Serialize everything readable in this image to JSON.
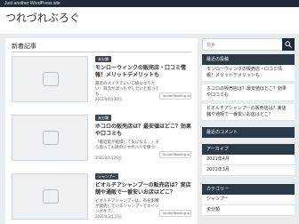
{
  "topbar": {
    "text": "Just another WordPress site"
  },
  "site": {
    "title": "つれづれぶろぐ"
  },
  "main": {
    "title": "新着記事",
    "cards": [
      {
        "category": "未分類",
        "title": "モンローウィンクの販売店・口コミ情報！メリットデメリットも",
        "excerpt": "最近のメイクでいい口癖になりたい！目元がぱっちりしたいと思っても...",
        "date": "2021年4月26日",
        "author": "lauderReading-si"
      },
      {
        "category": "未分類",
        "title": "ホコロの販売店は？最安値はどこ？効果や口コミも",
        "excerpt": "「最近肌が乾燥して気になる…」そう思っても顔のツヤやハリを保つ...",
        "date": "2021年4月26日",
        "author": "lauderReading-si"
      },
      {
        "category": "シャンプー",
        "title": "ビオルチアシャンプーの販売店は？実店舗や通販で一番安いお店はどこ？",
        "excerpt": "ビオルチアシャンプーは、有名影響が発売しているシャンプーでエイジングケア...",
        "date": "2021年3月17日",
        "author": "lauderReading-si"
      }
    ]
  },
  "sidebar": {
    "search_placeholder": "検索",
    "recent_title": "最近の投稿",
    "recent": [
      "モンローウィンクの販売店・口コミ情報！メリットデメリットも",
      "ホコロの販売店は？最安値はどこ？効果や口コミも",
      "ビオルチアシャンプーの販売店は？実店舗や通販で一番安いお店はどこ？"
    ],
    "comments_title": "最近のコメント",
    "archive_title": "アーカイブ",
    "archives": [
      "2021年4月",
      "2021年3月"
    ],
    "category_title": "カテゴリー",
    "categories": [
      "シャンプー",
      "未分類"
    ]
  }
}
